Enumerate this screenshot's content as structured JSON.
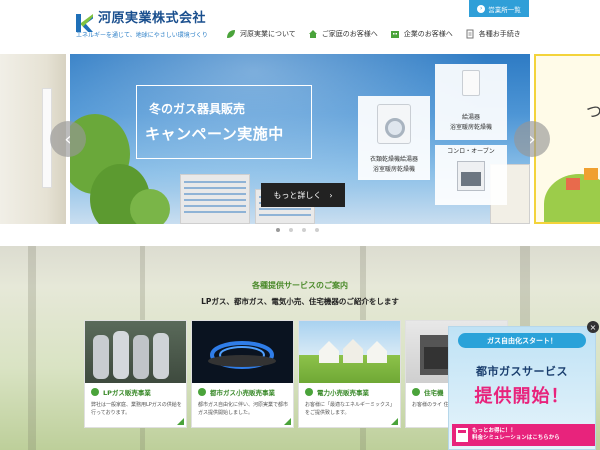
{
  "header": {
    "company_name": "河原実業株式会社",
    "tagline": "エネルギーを通じて、地球にやさしい環境づくり",
    "office_button": "営業所一覧",
    "nav": [
      {
        "label": "河原実業について",
        "icon": "leaf-icon"
      },
      {
        "label": "ご家庭のお客様へ",
        "icon": "house-icon"
      },
      {
        "label": "企業のお客様へ",
        "icon": "building-icon"
      },
      {
        "label": "各種お手続き",
        "icon": "document-icon"
      }
    ]
  },
  "hero": {
    "campaign_line1": "冬のガス器具販売",
    "campaign_line2": "キャンペーン実施中",
    "more_button": "もっと詳しく",
    "products": [
      {
        "label_line1": "衣類乾燥機給湯器",
        "label_line2": "浴室暖房乾燥機"
      },
      {
        "label_line1": "給湯器",
        "label_line2": "浴室暖房乾燥機"
      },
      {
        "label_line1": "コンロ・オーブン",
        "label_line2": ""
      }
    ],
    "right_slide_text": "つ",
    "dots_count": 4,
    "active_dot": 0
  },
  "services": {
    "title": "各種提供サービスのご案内",
    "subtitle": "LPガス、都市ガス、電気小売、住宅機器のご紹介をします",
    "cards": [
      {
        "title": "LPガス販売事業",
        "desc": "弊社は一般家庭、業務用LPガスの供給を行っております。"
      },
      {
        "title": "都市ガス小売販売事業",
        "desc": "都市ガス自由化に伴い、河原実業で都市ガス提供開始しました。"
      },
      {
        "title": "電力小売販売事業",
        "desc": "お客様に「最適なエネルギーミックス」をご提供致します。"
      },
      {
        "title": "住宅機",
        "desc": "お客様のライ 住設機器をご"
      }
    ]
  },
  "promo": {
    "badge": "ガス自由化スタート！",
    "line2": "都市ガスサービス",
    "line3": "提供開始！",
    "bottom_line1": "もっとお得に！！",
    "bottom_line2": "料金シミュレーションはこちらから",
    "close": "×"
  },
  "colors": {
    "brand_blue": "#1a4f8e",
    "accent_blue": "#2f9fd8",
    "green": "#4aa33a",
    "pink": "#e8237c"
  }
}
